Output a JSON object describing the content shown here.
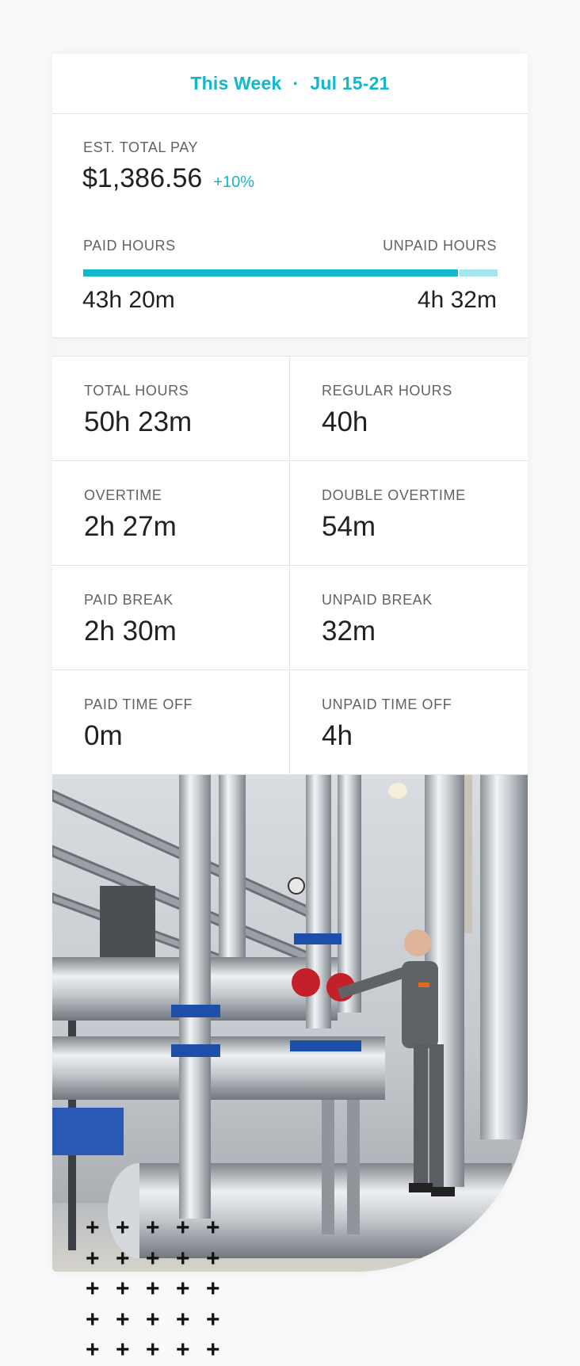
{
  "header": {
    "period": "This Week",
    "separator": "·",
    "dates": "Jul 15-21"
  },
  "pay": {
    "est_label": "EST. TOTAL PAY",
    "amount": "$1,386.56",
    "change": "+10%",
    "paid_label": "PAID HOURS",
    "unpaid_label": "UNPAID HOURS",
    "paid_value": "43h 20m",
    "unpaid_value": "4h 32m",
    "paid_fraction": 0.905
  },
  "stats": [
    {
      "label": "TOTAL HOURS",
      "value": "50h 23m"
    },
    {
      "label": "REGULAR HOURS",
      "value": "40h"
    },
    {
      "label": "OVERTIME",
      "value": "2h 27m"
    },
    {
      "label": "DOUBLE OVERTIME",
      "value": "54m"
    },
    {
      "label": "PAID BREAK",
      "value": "2h 30m"
    },
    {
      "label": "UNPAID BREAK",
      "value": "32m"
    },
    {
      "label": "PAID TIME OFF",
      "value": "0m"
    },
    {
      "label": "UNPAID TIME OFF",
      "value": "4h"
    }
  ],
  "decor": {
    "plus_symbol": "+",
    "plus_count": 25
  },
  "colors": {
    "accent": "#14b7c8",
    "bar_paid": "#12b9cb",
    "bar_unpaid": "#a5e6ec"
  }
}
